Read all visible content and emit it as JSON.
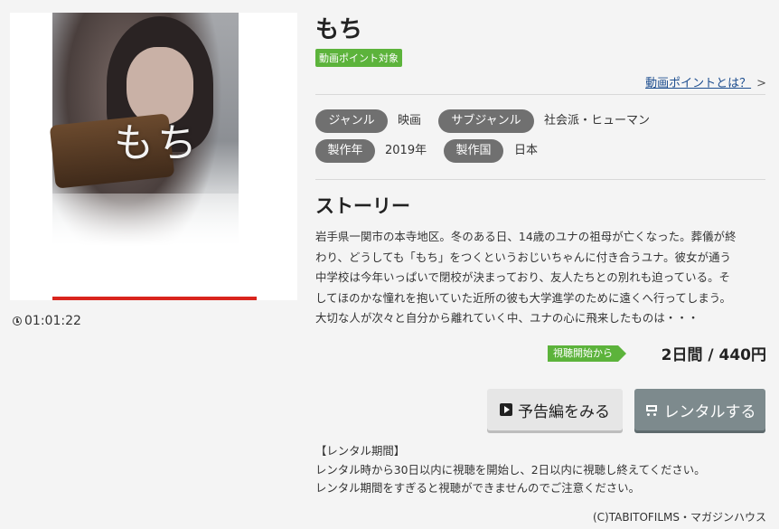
{
  "movie": {
    "title": "もち",
    "poster_title": "もち",
    "duration": "01:01:22",
    "point_badge": "動画ポイント対象",
    "point_link": "動画ポイントとは？",
    "point_link_chevron": ">"
  },
  "meta": {
    "genre_label": "ジャンル",
    "genre_value": "映画",
    "subgenre_label": "サブジャンル",
    "subgenre_value": "社会派・ヒューマン",
    "year_label": "製作年",
    "year_value": "2019年",
    "country_label": "製作国",
    "country_value": "日本"
  },
  "story": {
    "heading": "ストーリー",
    "lines": [
      "岩手県一関市の本寺地区。冬のある日、14歳のユナの祖母が亡くなった。葬儀が終",
      "わり、どうしても「もち」をつくというおじいちゃんに付き合うユナ。彼女が通う",
      "中学校は今年いっぱいで閉校が決まっており、友人たちとの別れも迫っている。そ",
      "してほのかな憧れを抱いていた近所の彼も大学進学のために遠くへ行ってしまう。",
      "大切な人が次々と自分から離れていく中、ユナの心に飛来したものは・・・"
    ]
  },
  "price": {
    "badge": "視聴開始から",
    "text": "2日間 / 440円"
  },
  "buttons": {
    "trailer": "予告編をみる",
    "rent": "レンタルする"
  },
  "rental_notice": {
    "heading": "【レンタル期間】",
    "line1": "レンタル時から30日以内に視聴を開始し、2日以内に視聴し終えてください。",
    "line2": "レンタル期間をすぎると視聴ができませんのでご注意ください。"
  },
  "copyright": "(C)TABITOFILMS・マガジンハウス",
  "colors": {
    "green": "#5cb33b",
    "tag_gray": "#707070",
    "rent_button": "#7d8a8d",
    "poster_bar": "#d9251d",
    "link_blue": "#1d4e8f"
  },
  "icons": [
    "clock-icon",
    "play-icon",
    "cart-icon",
    "chevron-right-icon"
  ]
}
